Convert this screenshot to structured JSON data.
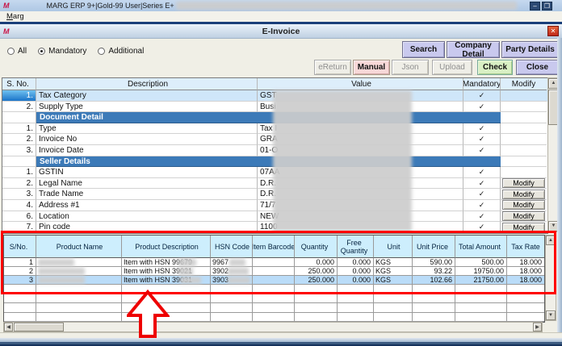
{
  "glyphs": {
    "logo": "M",
    "minimize": "–",
    "maximize": "❐",
    "close": "✕",
    "check": "✓",
    "up": "▲",
    "down": "▼",
    "left": "◀",
    "right": "▶"
  },
  "window": {
    "title": "MARG ERP 9+|Gold-99 User|Series E+",
    "menu_item": "Marg"
  },
  "dialog": {
    "title": "E-Invoice"
  },
  "filters": {
    "options": [
      {
        "label": "All",
        "selected": false
      },
      {
        "label": "Mandatory",
        "selected": true
      },
      {
        "label": "Additional",
        "selected": false
      }
    ]
  },
  "toolbar": {
    "search": "Search",
    "company_detail": "Company Detail",
    "party_details": "Party Details",
    "ereturn": "eReturn",
    "manual": "Manual",
    "json": "Json",
    "upload": "Upload",
    "check": "Check",
    "close": "Close"
  },
  "fields_table": {
    "headers": {
      "sno": "S. No.",
      "description": "Description",
      "value": "Value",
      "mandatory": "Mandatory",
      "modify": "Modify"
    },
    "modify_label": "Modify",
    "rows": [
      {
        "no": "1.",
        "label": "Tax Category",
        "value": "GST"
      },
      {
        "no": "2.",
        "label": "Supply Type",
        "value": "Busi"
      },
      {
        "section": "Document Detail"
      },
      {
        "no": "1.",
        "label": "Type",
        "value": "Tax I"
      },
      {
        "no": "2.",
        "label": "Invoice No",
        "value": "GRA"
      },
      {
        "no": "3.",
        "label": "Invoice Date",
        "value": "01-O"
      },
      {
        "section": "Seller Details"
      },
      {
        "no": "1.",
        "label": "GSTIN",
        "value": "07AA"
      },
      {
        "no": "2.",
        "label": "Legal Name",
        "value": "D.R."
      },
      {
        "no": "3.",
        "label": "Trade Name",
        "value": "D.R."
      },
      {
        "no": "4.",
        "label": "Address #1",
        "value": "71/7"
      },
      {
        "no": "6.",
        "label": "Location",
        "value": "NEW"
      },
      {
        "no": "7.",
        "label": "Pin code",
        "value": "1100"
      }
    ]
  },
  "items_table": {
    "headers": {
      "sno": "S/No.",
      "name": "Product Name",
      "description": "Product Description",
      "hsn": "HSN Code",
      "barcode": "Item Barcode",
      "qty": "Quantity",
      "free": "Free Quantity",
      "unit": "Unit",
      "price": "Unit Price",
      "total": "Total Amount",
      "tax": "Tax Rate"
    },
    "rows": [
      {
        "no": "1",
        "description": "Item with HSN 99679",
        "hsn": "9967",
        "qty": "0.000",
        "free": "0.000",
        "unit": "KGS",
        "price": "590.00",
        "total": "500.00",
        "tax": "18.000"
      },
      {
        "no": "2",
        "description": "Item with HSN 39021",
        "hsn": "3902",
        "qty": "250.000",
        "free": "0.000",
        "unit": "KGS",
        "price": "93.22",
        "total": "19750.00",
        "tax": "18.000"
      },
      {
        "no": "3",
        "description": "Item with HSN 39031",
        "hsn": "3903",
        "qty": "250.000",
        "free": "0.000",
        "unit": "KGS",
        "price": "102.66",
        "total": "21750.00",
        "tax": "18.000"
      }
    ]
  },
  "colors": {
    "annotation_red": "#ff0000",
    "section_band": "#3c7ab8",
    "selected_row": "#cfe6f9",
    "items_header": "#cdeefd",
    "items_selected_row": "#badcf8",
    "button_lavender": "#c9c9ee",
    "button_pink": "#f8d8d8",
    "button_green": "#d9f0c4"
  }
}
